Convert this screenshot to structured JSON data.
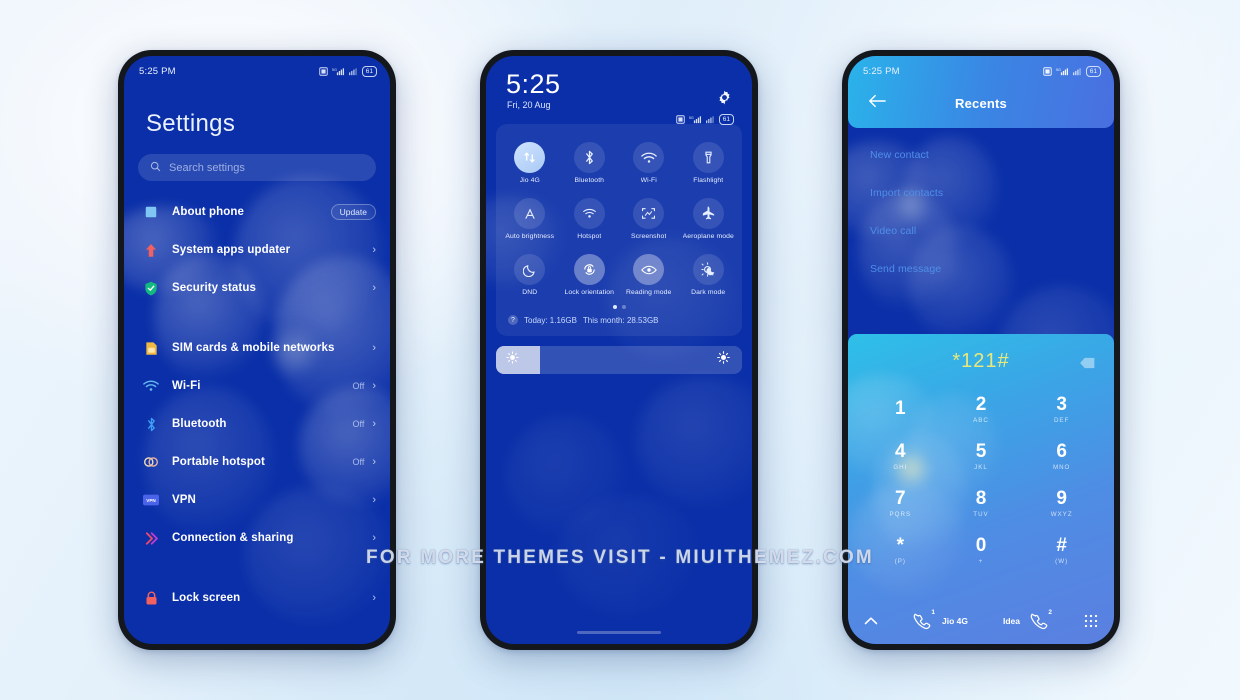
{
  "background": {
    "accent": "#0a2fa8",
    "page_bg": "#e9f4fc"
  },
  "watermark": {
    "text": "FOR MORE THEMES VISIT - MIUITHEMEZ.COM"
  },
  "phone1": {
    "status": {
      "time": "5:25 PM",
      "battery": "61"
    },
    "title": "Settings",
    "search": {
      "placeholder": "Search settings",
      "icon": "search-icon"
    },
    "items": [
      {
        "label": "About phone",
        "icon": "info-square-icon",
        "badge": "Update",
        "value": "",
        "chevron": false
      },
      {
        "label": "System apps updater",
        "icon": "up-arrow-icon",
        "badge": "",
        "value": "",
        "chevron": true
      },
      {
        "label": "Security status",
        "icon": "shield-check-icon",
        "badge": "",
        "value": "",
        "chevron": true
      },
      {
        "label": "SIM cards & mobile networks",
        "icon": "sim-card-icon",
        "badge": "",
        "value": "",
        "chevron": true,
        "group_break": true
      },
      {
        "label": "Wi-Fi",
        "icon": "wifi-icon",
        "badge": "",
        "value": "Off",
        "chevron": true
      },
      {
        "label": "Bluetooth",
        "icon": "bluetooth-icon",
        "badge": "",
        "value": "Off",
        "chevron": true
      },
      {
        "label": "Portable hotspot",
        "icon": "hotspot-icon",
        "badge": "",
        "value": "Off",
        "chevron": true
      },
      {
        "label": "VPN",
        "icon": "vpn-icon",
        "badge": "",
        "value": "",
        "chevron": true
      },
      {
        "label": "Connection & sharing",
        "icon": "connection-share-icon",
        "badge": "",
        "value": "",
        "chevron": true
      },
      {
        "label": "Lock screen",
        "icon": "lock-icon",
        "badge": "",
        "value": "",
        "chevron": true,
        "group_break": true
      }
    ]
  },
  "phone2": {
    "status": {
      "time": "5:25",
      "date": "Fri, 20 Aug",
      "battery": "61"
    },
    "gear_icon": "gear-icon",
    "toggles": [
      {
        "label": "Jio 4G",
        "icon": "mobile-data-icon",
        "state": "on"
      },
      {
        "label": "Bluetooth",
        "icon": "bluetooth-icon",
        "state": "off"
      },
      {
        "label": "Wi-Fi",
        "icon": "wifi-icon",
        "state": "off"
      },
      {
        "label": "Flashlight",
        "icon": "flashlight-icon",
        "state": "off"
      },
      {
        "label": "Auto brightness",
        "icon": "auto-brightness-icon",
        "state": "off"
      },
      {
        "label": "Hotspot",
        "icon": "hotspot-icon",
        "state": "off"
      },
      {
        "label": "Screenshot",
        "icon": "screenshot-icon",
        "state": "off"
      },
      {
        "label": "Aeroplane mode",
        "icon": "airplane-icon",
        "state": "off"
      },
      {
        "label": "DND",
        "icon": "moon-icon",
        "state": "off"
      },
      {
        "label": "Lock orientation",
        "icon": "rotation-lock-icon",
        "state": "on-light"
      },
      {
        "label": "Reading mode",
        "icon": "eye-icon",
        "state": "on-light"
      },
      {
        "label": "Dark mode",
        "icon": "dark-mode-icon",
        "state": "off"
      }
    ],
    "pages": {
      "count": 2,
      "active": 0
    },
    "data_usage": {
      "today_label": "Today: 1.16GB",
      "month_label": "This month: 28.53GB",
      "help_icon": "question-icon"
    },
    "brightness": {
      "level_percent": 18,
      "low_icon": "brightness-low-icon",
      "high_icon": "brightness-high-icon"
    }
  },
  "phone3": {
    "status": {
      "time": "5:25 PM",
      "battery": "61"
    },
    "header": {
      "title": "Recents",
      "back_icon": "back-arrow-icon"
    },
    "menu": [
      {
        "label": "New contact"
      },
      {
        "label": "Import contacts"
      },
      {
        "label": "Video call"
      },
      {
        "label": "Send message"
      }
    ],
    "dialer": {
      "number": "*121#",
      "delete_icon": "backspace-icon",
      "keys": [
        {
          "digit": "1",
          "sub": ""
        },
        {
          "digit": "2",
          "sub": "ABC"
        },
        {
          "digit": "3",
          "sub": "DEF"
        },
        {
          "digit": "4",
          "sub": "GHI"
        },
        {
          "digit": "5",
          "sub": "JKL"
        },
        {
          "digit": "6",
          "sub": "MNO"
        },
        {
          "digit": "7",
          "sub": "PQRS"
        },
        {
          "digit": "8",
          "sub": "TUV"
        },
        {
          "digit": "9",
          "sub": "WXYZ"
        },
        {
          "digit": "*",
          "sub": "(P)"
        },
        {
          "digit": "0",
          "sub": "+"
        },
        {
          "digit": "#",
          "sub": "(W)"
        }
      ],
      "callbar": {
        "expand_icon": "chevron-up-icon",
        "sim1": {
          "icon": "call-icon",
          "sup": "1",
          "label": "Jio 4G"
        },
        "sim2": {
          "icon": "call-icon",
          "sup": "2",
          "label": "Idea"
        },
        "keypad_icon": "keypad-icon"
      }
    }
  }
}
